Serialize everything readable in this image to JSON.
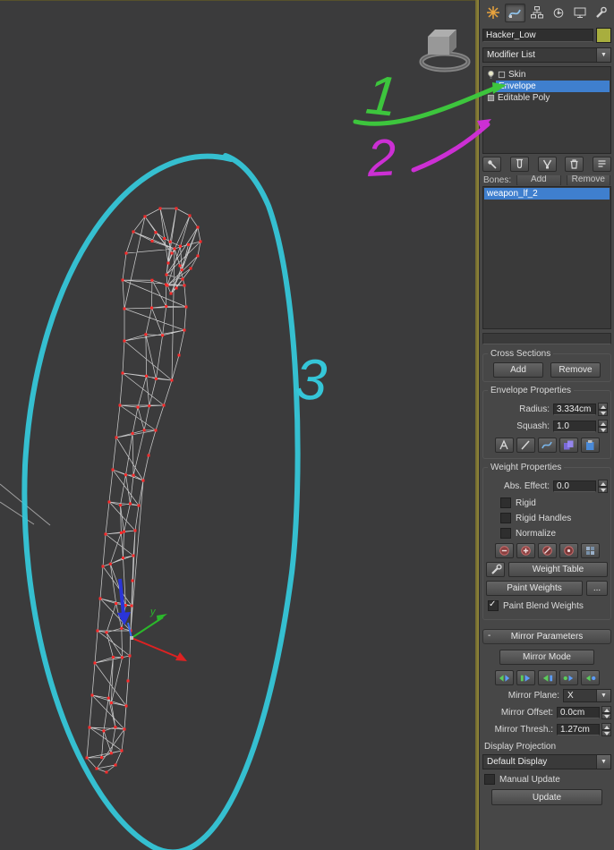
{
  "viewport": {
    "annotation_1": "1",
    "annotation_2": "2",
    "annotation_3": "3",
    "gizmo_y_label": "y",
    "annotation_colors": {
      "green": "#3dc53d",
      "magenta": "#cc2fd4",
      "cyan": "#35c6d8"
    }
  },
  "command_panel": {
    "tabs": [
      "create",
      "modify",
      "hierarchy",
      "motion",
      "display",
      "utilities"
    ],
    "active_tab": "modify",
    "object_name": "Hacker_Low",
    "object_color": "#a8ae3e",
    "modifier_list": {
      "label": "Modifier List"
    },
    "modifier_stack": {
      "items": [
        {
          "label": "Skin",
          "selected": false
        },
        {
          "label": "Envelope",
          "selected": true
        },
        {
          "label": "Editable Poly",
          "selected": false
        }
      ]
    },
    "stack_tool_icons": [
      "pin-stack-icon",
      "show-end-result-icon",
      "make-unique-icon",
      "remove-modifier-icon",
      "configure-modifier-sets-icon"
    ],
    "bones": {
      "label": "Bones:",
      "add_label": "Add",
      "remove_label": "Remove",
      "items": [
        {
          "name": "weapon_lf_2",
          "selected": true
        }
      ]
    },
    "cross_sections": {
      "title": "Cross Sections",
      "add_label": "Add",
      "remove_label": "Remove"
    },
    "envelope_properties": {
      "title": "Envelope Properties",
      "radius_label": "Radius:",
      "radius_value": "3.334cm",
      "squash_label": "Squash:",
      "squash_value": "1.0"
    },
    "weight_properties": {
      "title": "Weight Properties",
      "abs_effect_label": "Abs. Effect:",
      "abs_effect_value": "0.0",
      "rigid_label": "Rigid",
      "rigid_handles_label": "Rigid Handles",
      "normalize_label": "Normalize",
      "weight_table_label": "Weight Table",
      "paint_weights_label": "Paint Weights",
      "paint_options_label": "...",
      "paint_blend_weights_label": "Paint Blend Weights",
      "paint_blend_weights_checked": true
    },
    "mirror_parameters": {
      "collapse_glyph": "-",
      "title": "Mirror Parameters",
      "mirror_mode_label": "Mirror Mode",
      "mirror_plane_label": "Mirror Plane:",
      "mirror_plane_value": "X",
      "mirror_offset_label": "Mirror Offset:",
      "mirror_offset_value": "0.0cm",
      "mirror_thresh_label": "Mirror Thresh.:",
      "mirror_thresh_value": "1.27cm",
      "display_projection_label": "Display Projection",
      "display_projection_value": "Default Display",
      "manual_update_label": "Manual Update",
      "update_label": "Update"
    }
  }
}
